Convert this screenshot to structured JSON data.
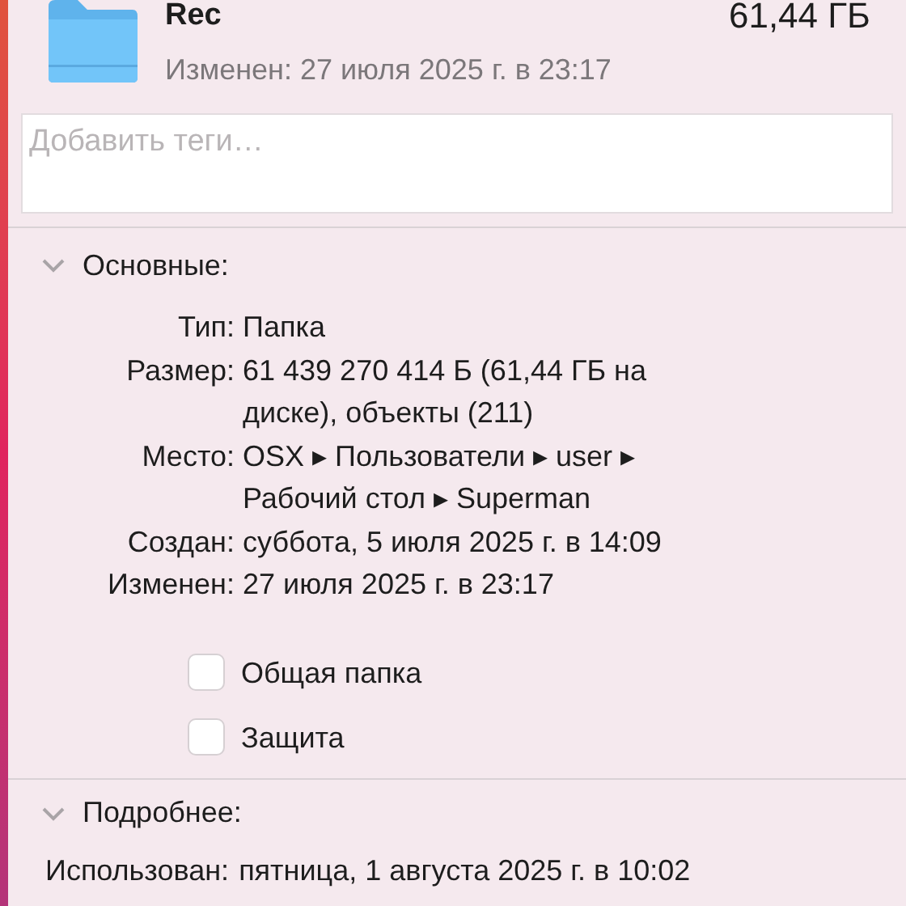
{
  "header": {
    "name": "Rec",
    "size": "61,44 ГБ",
    "modified": "Изменен: 27 июля 2025 г. в 23:17"
  },
  "tags_field": {
    "placeholder": "Добавить теги…"
  },
  "general": {
    "title": "Основные:",
    "expanded": true,
    "rows": [
      {
        "label": "Тип:",
        "value": "Папка"
      },
      {
        "label": "Размер:",
        "value": "61 439 270 414 Б (61,44 ГБ на диске), объекты (211)"
      },
      {
        "label": "Место:",
        "value": "OSX ▸ Пользователи ▸ user ▸ Рабочий стол ▸ Superman"
      },
      {
        "label": "Создан:",
        "value": "суббота, 5 июля 2025 г. в 14:09"
      },
      {
        "label": "Изменен:",
        "value": "27 июля 2025 г. в 23:17"
      }
    ],
    "checkboxes": [
      {
        "label": "Общая папка",
        "checked": false
      },
      {
        "label": "Защита",
        "checked": false
      }
    ]
  },
  "more_info": {
    "title": "Подробнее:",
    "expanded": true,
    "rows": [
      {
        "label": "Использован:",
        "value": "пятница, 1 августа 2025 г. в 10:02"
      }
    ]
  }
}
